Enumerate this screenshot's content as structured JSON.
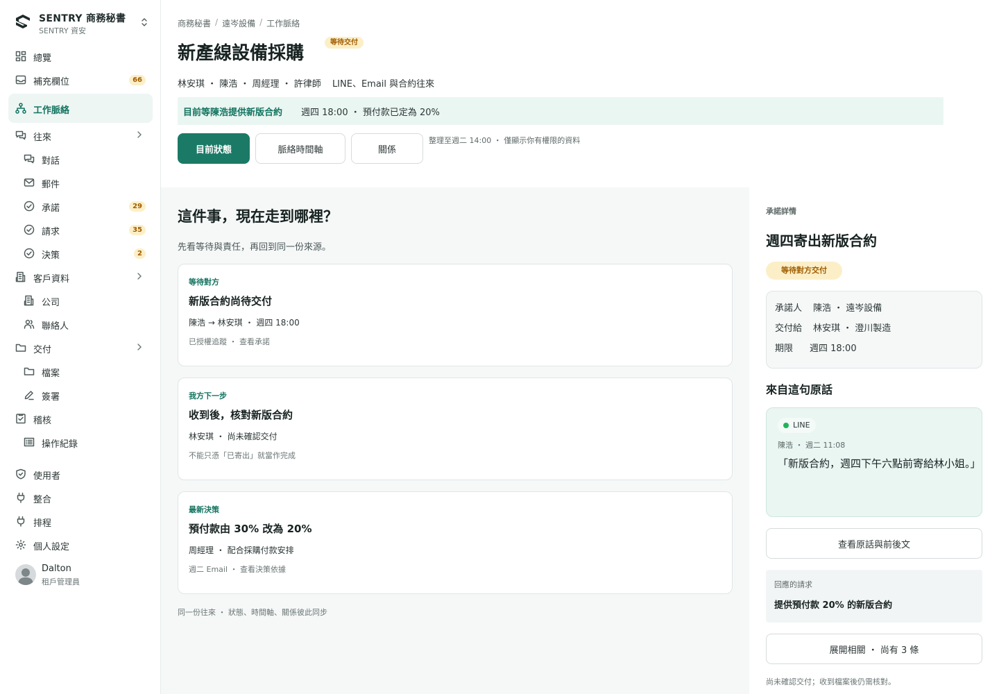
{
  "brand": {
    "name": "SENTRY 商務秘書",
    "sub": "SENTRY 資安"
  },
  "nav": {
    "overview": "總覽",
    "fields": {
      "label": "補充欄位",
      "count": "66"
    },
    "context": "工作脈絡",
    "threads": "往來",
    "conversations": "對話",
    "mail": "郵件",
    "commitments": {
      "label": "承諾",
      "count": "29"
    },
    "requests": {
      "label": "請求",
      "count": "35"
    },
    "decisions": {
      "label": "決策",
      "count": "2"
    },
    "customers": "客戶資料",
    "companies": "公司",
    "contacts": "聯絡人",
    "deliveries": "交付",
    "files": "檔案",
    "signatures": "簽署",
    "audit": "稽核",
    "oplog": "操作紀錄",
    "users": "使用者",
    "integrations": "整合",
    "schedule": "排程",
    "settings": "個人設定"
  },
  "user": {
    "name": "Dalton",
    "role": "租戶管理員"
  },
  "breadcrumb": {
    "a": "商務秘書",
    "b": "遠岑設備",
    "c": "工作脈絡",
    "sep": "/"
  },
  "page": {
    "title": "新產線設備採購",
    "badge": "等待交付",
    "participants": "林安琪 ・ 陳浩 ・ 周經理 ・ 許律師",
    "channels": "LINE、Email 與合約往來",
    "status_strong": "目前等陳浩提供新版合約",
    "status_rest": "週四 18:00 ・ 預付款已定為 20%"
  },
  "tabs": {
    "status": "目前狀態",
    "timeline": "脈絡時間軸",
    "relations": "關係",
    "note": "整理至週二 14:00 ・ 僅顯示你有權限的資料"
  },
  "main": {
    "question": "這件事，現在走到哪裡？",
    "sub": "先看等待與責任，再回到同一份來源。",
    "cards": [
      {
        "kicker": "等待對方",
        "title": "新版合約尚待交付",
        "line": "陳浩 → 林安琪 ・ 週四 18:00",
        "meta": "已授權追蹤 ・ 查看承諾"
      },
      {
        "kicker": "我方下一步",
        "title": "收到後，核對新版合約",
        "line": "林安琪 ・ 尚未確認交付",
        "meta": "不能只憑「已寄出」就當作完成"
      },
      {
        "kicker": "最新決策",
        "title": "預付款由 30% 改為 20%",
        "line": "周經理 ・ 配合採購付款安排",
        "meta": "週二 Email ・ 查看決策依據"
      }
    ],
    "sync": "同一份往來 ・ 狀態、時間軸、關係彼此同步"
  },
  "detail": {
    "label": "承諾詳情",
    "title": "週四寄出新版合約",
    "badge": "等待對方交付",
    "promiser_k": "承諾人",
    "promiser_v": "陳浩 ・ 遠岑設備",
    "deliver_k": "交付給",
    "deliver_v": "林安琪 ・ 澄川製造",
    "due_k": "期限",
    "due_v": "週四 18:00",
    "source_heading": "來自這句原話",
    "channel": "LINE",
    "quote_meta": "陳浩 ・ 週二 11:08",
    "quote": "「新版合約，週四下午六點前寄給林小姐。」",
    "view_source": "查看原話與前後文",
    "req_label": "回應的請求",
    "req_text": "提供預付款 20% 的新版合約",
    "expand": "展開相關 ・ 尚有 3 條",
    "footnote": "尚未確認交付；收到檔案後仍需核對。"
  }
}
